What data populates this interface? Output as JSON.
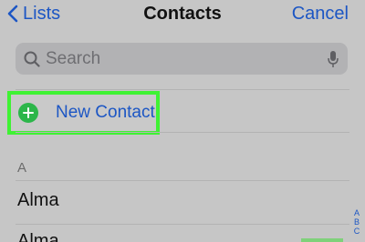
{
  "nav": {
    "back_label": "Lists",
    "title": "Contacts",
    "cancel_label": "Cancel"
  },
  "search": {
    "placeholder": "Search",
    "value": ""
  },
  "new_contact": {
    "label": "New Contact",
    "highlight_color": "#3ff233",
    "icon_color": "#2cb64a"
  },
  "section": {
    "header": "A",
    "contacts": [
      "Alma",
      "Alma"
    ]
  },
  "index": [
    "A",
    "B",
    "C"
  ],
  "colors": {
    "accent": "#1c56c4",
    "background": "#c6c6c6"
  },
  "icons": [
    "chevron-left-icon",
    "search-icon",
    "microphone-icon",
    "plus-circle-icon"
  ]
}
